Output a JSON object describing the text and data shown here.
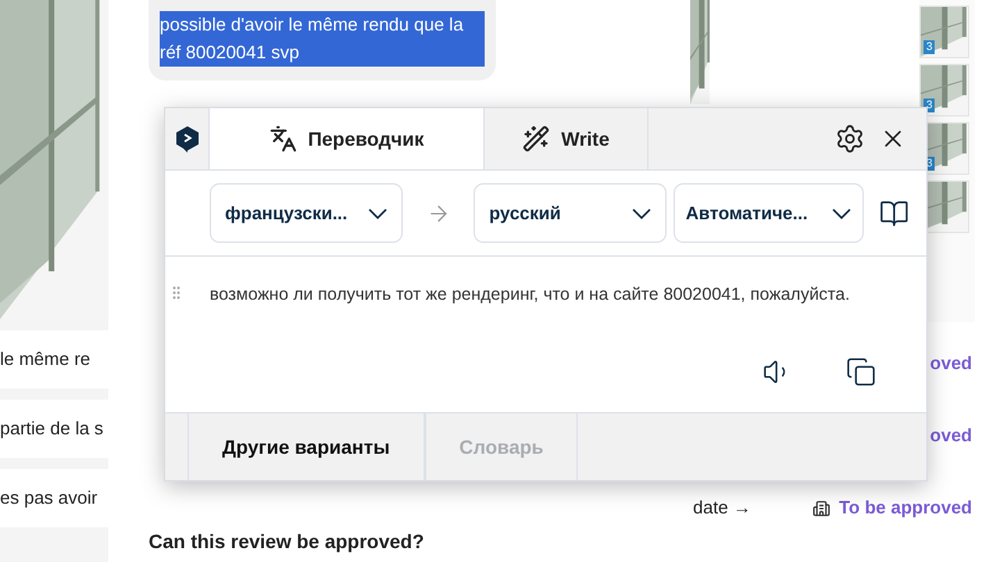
{
  "page": {
    "left_rows": [
      "le même re",
      "partie de la s",
      "es pas avoir"
    ],
    "message": {
      "text": "possible d'avoir le même rendu que la réf 80020041 svp",
      "selected": true
    },
    "question": "Can this review be approved?",
    "right_rows": [
      {
        "status": "oved"
      },
      {
        "status": "oved"
      },
      {
        "link": "date →",
        "status": "To be approved"
      }
    ],
    "thumbnails": [
      {
        "badge": "3"
      },
      {
        "badge": "3"
      },
      {
        "badge": "3"
      }
    ]
  },
  "translator": {
    "tabs": [
      {
        "label": "Переводчик",
        "selected": true
      },
      {
        "label": "Write",
        "selected": false
      }
    ],
    "source_language": "французски...",
    "target_language": "русский",
    "formality": "Автоматиче...",
    "translation": "возможно ли получить тот же рендеринг, что и на сайте 80020041, пожалуйста.",
    "footer_tabs": [
      {
        "label": "Другие варианты",
        "disabled": false
      },
      {
        "label": "Словарь",
        "disabled": true
      }
    ]
  }
}
